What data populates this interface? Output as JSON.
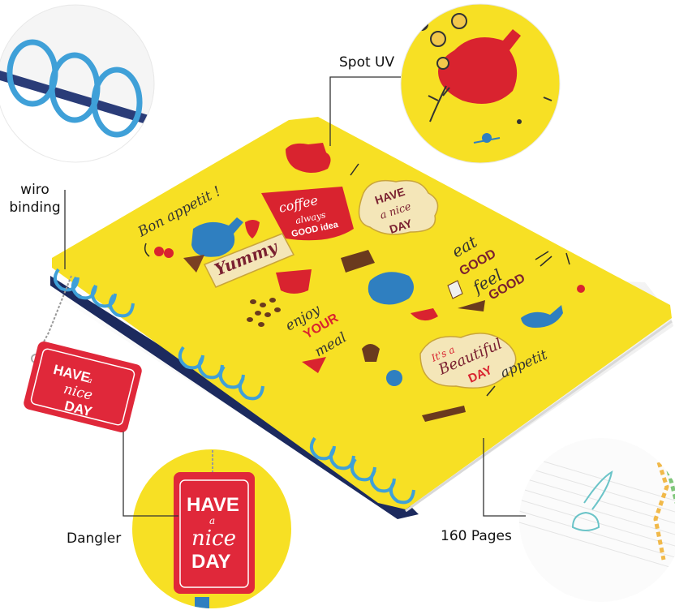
{
  "callouts": {
    "spot_uv": "Spot UV",
    "wiro_binding": "wiro\nbinding",
    "dangler": "Dangler",
    "pages": "160 Pages"
  },
  "cover_art": {
    "bon_appetit": "Bon appetit !",
    "coffee_1": "coffee",
    "coffee_2": "always",
    "coffee_3": "GOOD idea",
    "have_nice_day_1": "HAVE",
    "have_nice_day_2": "a nice",
    "have_nice_day_3": "DAY",
    "yummy": "Yummy",
    "eat": "eat",
    "good1": "GOOD",
    "feel": "feel",
    "good2": "GOOD",
    "enjoy": "enjoy",
    "your": "YOUR",
    "meal": "meal",
    "beautiful_1": "It's a",
    "beautiful_2": "Beautiful",
    "beautiful_3": "DAY",
    "appetit": "appetit"
  },
  "dangler_tag": {
    "line1": "HAVE",
    "line2": "a",
    "line3": "nice",
    "line4": "DAY"
  },
  "colors": {
    "cover_yellow": "#f7e024",
    "wire_blue": "#3fa0d8",
    "tag_red": "#e0283a",
    "navy_edge": "#1c2a5e",
    "ink": "#2a2a2a"
  }
}
